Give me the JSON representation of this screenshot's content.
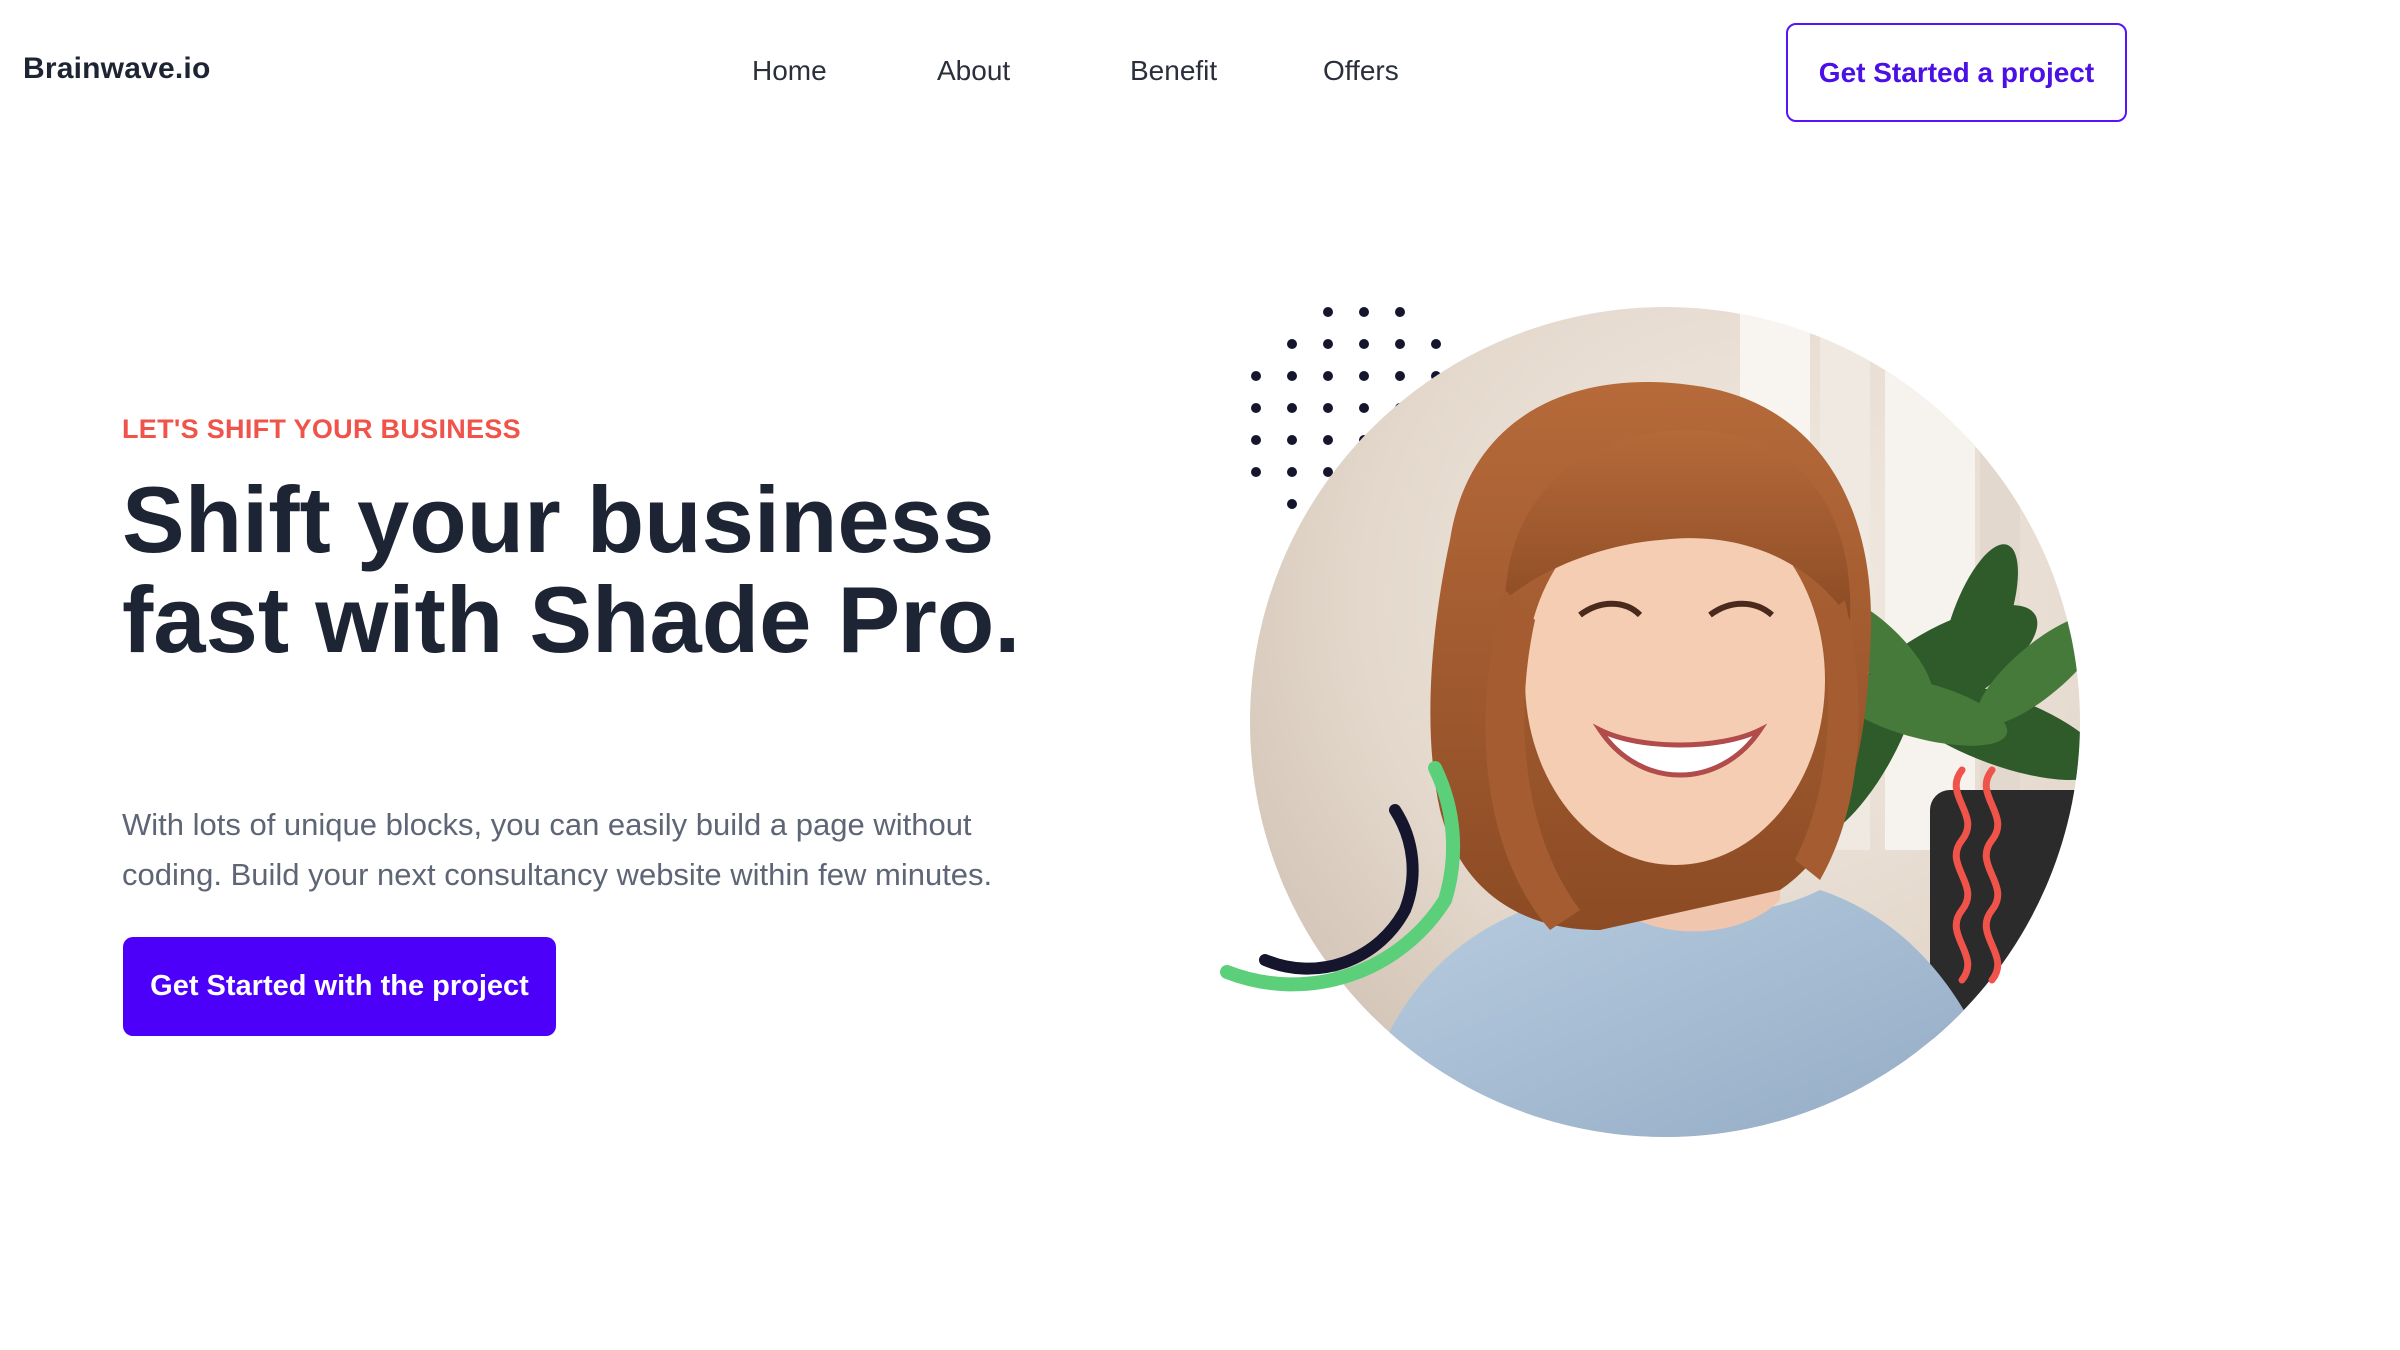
{
  "header": {
    "brand": "Brainwave.io",
    "nav": [
      "Home",
      "About",
      "Benefit",
      "Offers"
    ],
    "cta_label": "Get Started a project"
  },
  "hero": {
    "eyebrow": "LET'S SHIFT YOUR BUSINESS",
    "headline": "Shift your business fast with Shade Pro.",
    "subtext": "With lots of unique blocks, you can easily build a page without coding. Build your next consultancy website within few minutes.",
    "cta_label": "Get Started with the project"
  },
  "colors": {
    "primary": "#4c00fa",
    "accent_red": "#f0534a",
    "accent_green": "#5ccf7b",
    "heading": "#1d2433",
    "dots": "#15162e"
  },
  "image": {
    "subject": "smiling woman with auburn hair and bangs",
    "decorations": [
      "dot-grid",
      "green-arc",
      "navy-arc",
      "red-squiggles"
    ]
  }
}
